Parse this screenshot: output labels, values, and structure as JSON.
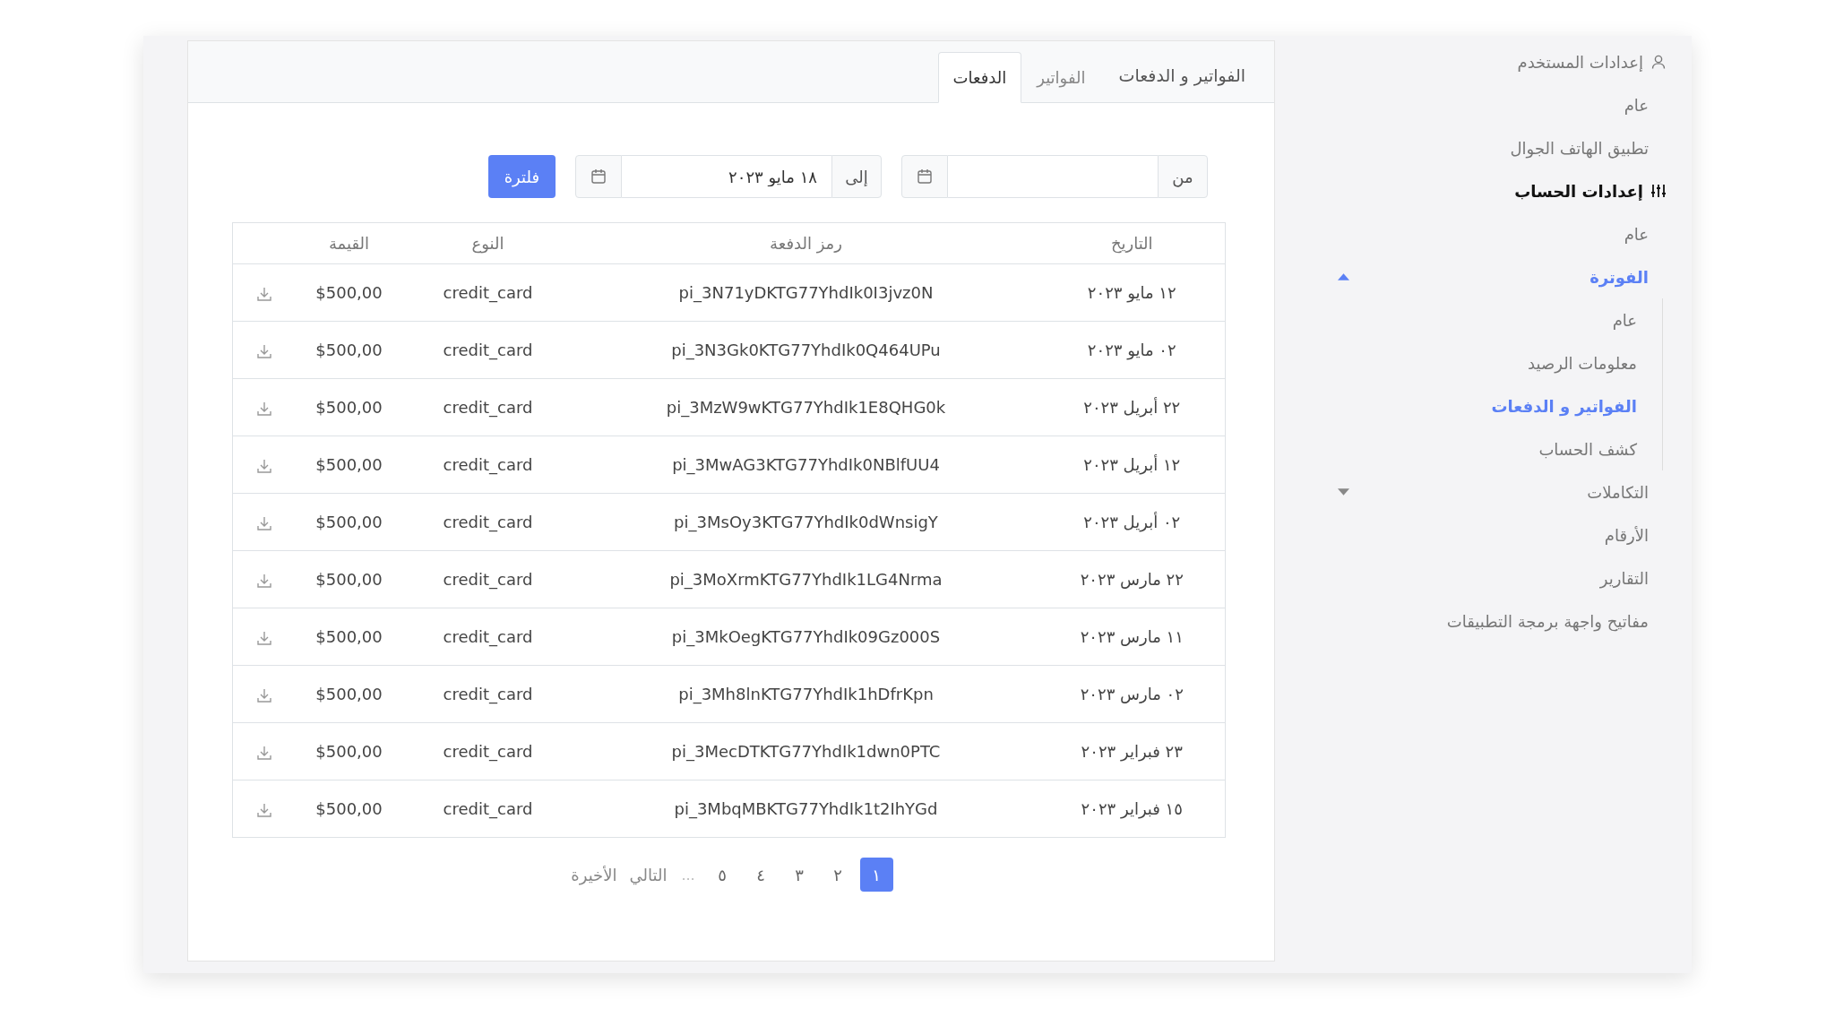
{
  "sidebar": {
    "sections": [
      {
        "kind": "user",
        "label": "إعدادات المستخدم",
        "active": false,
        "items": [
          {
            "label": "عام",
            "selected": false
          },
          {
            "label": "تطبيق الهاتف الجوال",
            "selected": false
          }
        ]
      },
      {
        "kind": "sliders",
        "label": "إعدادات الحساب",
        "active": true,
        "items": [
          {
            "label": "عام",
            "selected": false
          },
          {
            "label": "الفوترة",
            "selected": true,
            "expanded": true,
            "children": [
              {
                "label": "عام",
                "selected": false
              },
              {
                "label": "معلومات الرصيد",
                "selected": false
              },
              {
                "label": "الفواتير و الدفعات",
                "selected": true
              },
              {
                "label": "كشف الحساب",
                "selected": false
              }
            ]
          },
          {
            "label": "التكاملات",
            "selected": false,
            "expanded": false
          },
          {
            "label": "الأرقام",
            "selected": false
          },
          {
            "label": "التقارير",
            "selected": false
          },
          {
            "label": "مفاتيح واجهة برمجة التطبيقات",
            "selected": false
          }
        ]
      }
    ]
  },
  "panel": {
    "title": "الفواتير و الدفعات",
    "tabs": [
      {
        "label": "الفواتير",
        "selected": false
      },
      {
        "label": "الدفعات",
        "selected": true
      }
    ],
    "filter": {
      "from": {
        "label": "من"
      },
      "to": {
        "label": "إلى",
        "value": "١٨ مايو ٢٠٢٣"
      },
      "button": "فلترة"
    },
    "table": {
      "columns": [
        "التاريخ",
        "رمز الدفعة",
        "النوع",
        "القيمة"
      ],
      "rows": [
        {
          "date": "١٢ مايو ٢٠٢٣",
          "code": "pi_3N71yDKTG77YhdIk0I3jvz0N",
          "type": "credit_card",
          "amount": "$500,00"
        },
        {
          "date": "٠٢ مايو ٢٠٢٣",
          "code": "pi_3N3Gk0KTG77YhdIk0Q464UPu",
          "type": "credit_card",
          "amount": "$500,00"
        },
        {
          "date": "٢٢ أبريل ٢٠٢٣",
          "code": "pi_3MzW9wKTG77YhdIk1E8QHG0k",
          "type": "credit_card",
          "amount": "$500,00"
        },
        {
          "date": "١٢ أبريل ٢٠٢٣",
          "code": "pi_3MwAG3KTG77YhdIk0NBlfUU4",
          "type": "credit_card",
          "amount": "$500,00"
        },
        {
          "date": "٠٢ أبريل ٢٠٢٣",
          "code": "pi_3MsOy3KTG77YhdIk0dWnsigY",
          "type": "credit_card",
          "amount": "$500,00"
        },
        {
          "date": "٢٢ مارس ٢٠٢٣",
          "code": "pi_3MoXrmKTG77YhdIk1LG4Nrma",
          "type": "credit_card",
          "amount": "$500,00"
        },
        {
          "date": "١١ مارس ٢٠٢٣",
          "code": "pi_3MkOegKTG77YhdIk09Gz000S",
          "type": "credit_card",
          "amount": "$500,00"
        },
        {
          "date": "٠٢ مارس ٢٠٢٣",
          "code": "pi_3Mh8lnKTG77YhdIk1hDfrKpn",
          "type": "credit_card",
          "amount": "$500,00"
        },
        {
          "date": "٢٣ فبراير ٢٠٢٣",
          "code": "pi_3MecDTKTG77YhdIk1dwn0PTC",
          "type": "credit_card",
          "amount": "$500,00"
        },
        {
          "date": "١٥ فبراير ٢٠٢٣",
          "code": "pi_3MbqMBKTG77YhdIk1t2IhYGd",
          "type": "credit_card",
          "amount": "$500,00"
        }
      ]
    },
    "pagination": {
      "pages": [
        {
          "label": "١",
          "selected": true
        },
        {
          "label": "٢",
          "selected": false
        },
        {
          "label": "٣",
          "selected": false
        },
        {
          "label": "٤",
          "selected": false
        },
        {
          "label": "٥",
          "selected": false
        }
      ],
      "ellipsis": "...",
      "next": "التالي",
      "last": "الأخيرة"
    }
  }
}
